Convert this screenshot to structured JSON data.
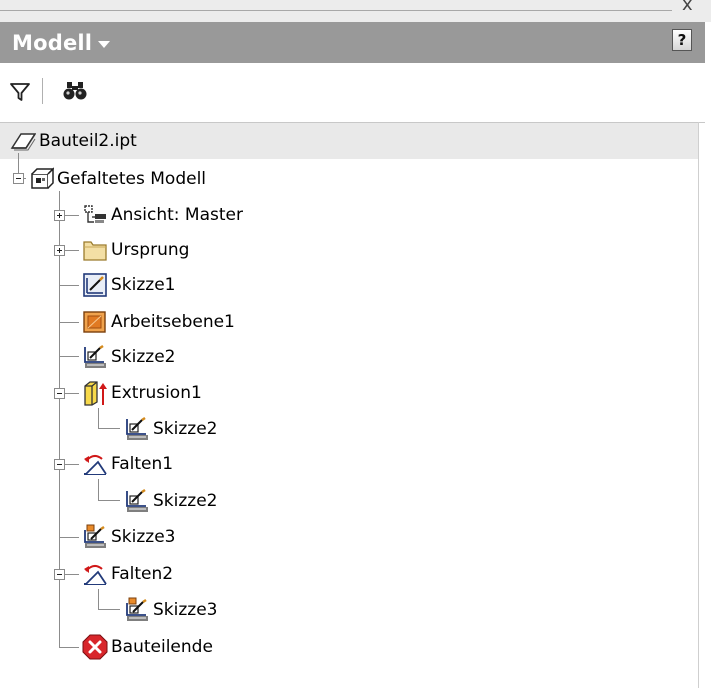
{
  "panel": {
    "title": "Modell",
    "help_label": "?",
    "close_glyph": "x"
  },
  "toolbar": {
    "filter_icon": "filter-icon",
    "search_icon": "binoculars-icon"
  },
  "tree": {
    "root": {
      "label": "Bauteil2.ipt",
      "icon": "part-icon"
    },
    "folded_model": {
      "label": "Gefaltetes Modell",
      "icon": "folded-model-icon",
      "expanded": true
    },
    "items": [
      {
        "label": "Ansicht: Master",
        "icon": "view-icon",
        "expander": "plus"
      },
      {
        "label": "Ursprung",
        "icon": "folder-icon",
        "expander": "plus"
      },
      {
        "label": "Skizze1",
        "icon": "sketch-icon"
      },
      {
        "label": "Arbeitsebene1",
        "icon": "work-plane-icon"
      },
      {
        "label": "Skizze2",
        "icon": "sketch-3d-icon"
      },
      {
        "label": "Extrusion1",
        "icon": "extrusion-icon",
        "expander": "minus",
        "children": [
          {
            "label": "Skizze2",
            "icon": "sketch-3d-icon"
          }
        ]
      },
      {
        "label": "Falten1",
        "icon": "fold-icon",
        "expander": "minus",
        "children": [
          {
            "label": "Skizze2",
            "icon": "sketch-3d-icon"
          }
        ]
      },
      {
        "label": "Skizze3",
        "icon": "sketch-consumed-icon"
      },
      {
        "label": "Falten2",
        "icon": "fold-icon",
        "expander": "minus",
        "children": [
          {
            "label": "Skizze3",
            "icon": "sketch-consumed-icon"
          }
        ]
      },
      {
        "label": "Bauteilende",
        "icon": "end-of-part-icon"
      }
    ]
  },
  "colors": {
    "header_bg": "#999999",
    "root_row_bg": "#e9e9e9",
    "tree_line": "#8c8c8c"
  }
}
